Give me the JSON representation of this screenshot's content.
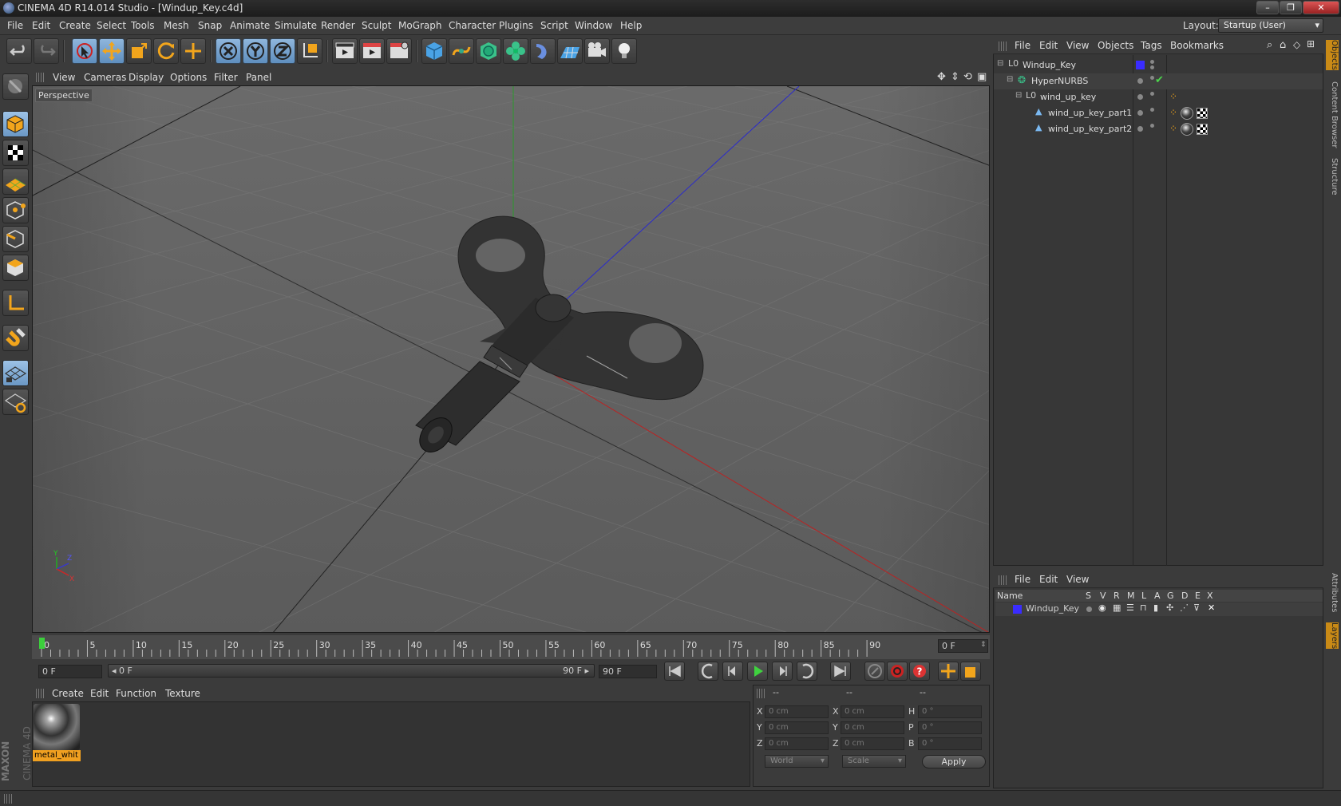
{
  "window": {
    "title": "CINEMA 4D R14.014 Studio - [Windup_Key.c4d]"
  },
  "menu": [
    "File",
    "Edit",
    "Create",
    "Select",
    "Tools",
    "Mesh",
    "Snap",
    "Animate",
    "Simulate",
    "Render",
    "Sculpt",
    "MoGraph",
    "Character",
    "Plugins",
    "Script",
    "Window",
    "Help"
  ],
  "layout": {
    "label": "Layout:",
    "value": "Startup (User)"
  },
  "viewport": {
    "menu": [
      "View",
      "Cameras",
      "Display",
      "Options",
      "Filter",
      "Panel"
    ],
    "label": "Perspective",
    "axis_labels": {
      "y": "Y",
      "z": "Z",
      "x": "X"
    }
  },
  "timeline": {
    "ticks": [
      "0",
      "5",
      "10",
      "15",
      "20",
      "25",
      "30",
      "35",
      "40",
      "45",
      "50",
      "55",
      "60",
      "65",
      "70",
      "75",
      "80",
      "85",
      "90"
    ],
    "end_frame": "0 F"
  },
  "transport": {
    "current": "0 F",
    "range_start": "0 F",
    "range_end": "90 F",
    "max": "90 F"
  },
  "material": {
    "menu": [
      "Create",
      "Edit",
      "Function",
      "Texture"
    ],
    "items": [
      {
        "name": "metal_whit"
      }
    ]
  },
  "coords": {
    "headers": [
      "--",
      "--",
      "--"
    ],
    "rows": [
      {
        "l1": "X",
        "v1": "0 cm",
        "l2": "X",
        "v2": "0 cm",
        "l3": "H",
        "v3": "0 °"
      },
      {
        "l1": "Y",
        "v1": "0 cm",
        "l2": "Y",
        "v2": "0 cm",
        "l3": "P",
        "v3": "0 °"
      },
      {
        "l1": "Z",
        "v1": "0 cm",
        "l2": "Z",
        "v2": "0 cm",
        "l3": "B",
        "v3": "0 °"
      }
    ],
    "world": "World",
    "scale": "Scale",
    "apply": "Apply"
  },
  "objects": {
    "menu": [
      "File",
      "Edit",
      "View",
      "Objects",
      "Tags",
      "Bookmarks"
    ],
    "items": [
      {
        "name": "Windup_Key",
        "depth": 0
      },
      {
        "name": "HyperNURBS",
        "depth": 1
      },
      {
        "name": "wind_up_key",
        "depth": 2
      },
      {
        "name": "wind_up_key_part1",
        "depth": 3
      },
      {
        "name": "wind_up_key_part2",
        "depth": 3
      }
    ],
    "layer_color": "#3a2cff",
    "check_color": "#4cd64c"
  },
  "layers": {
    "menu": [
      "File",
      "Edit",
      "View"
    ],
    "columns": [
      "Name",
      "S",
      "V",
      "R",
      "M",
      "L",
      "A",
      "G",
      "D",
      "E",
      "X"
    ],
    "rows": [
      {
        "name": "Windup_Key",
        "color": "#3a2cff"
      }
    ]
  },
  "side_tabs": [
    "Objects",
    "Content Browser",
    "Structure",
    "Attributes",
    "Layers"
  ],
  "brand": {
    "line1": "MAXON",
    "line2": "CINEMA 4D"
  }
}
